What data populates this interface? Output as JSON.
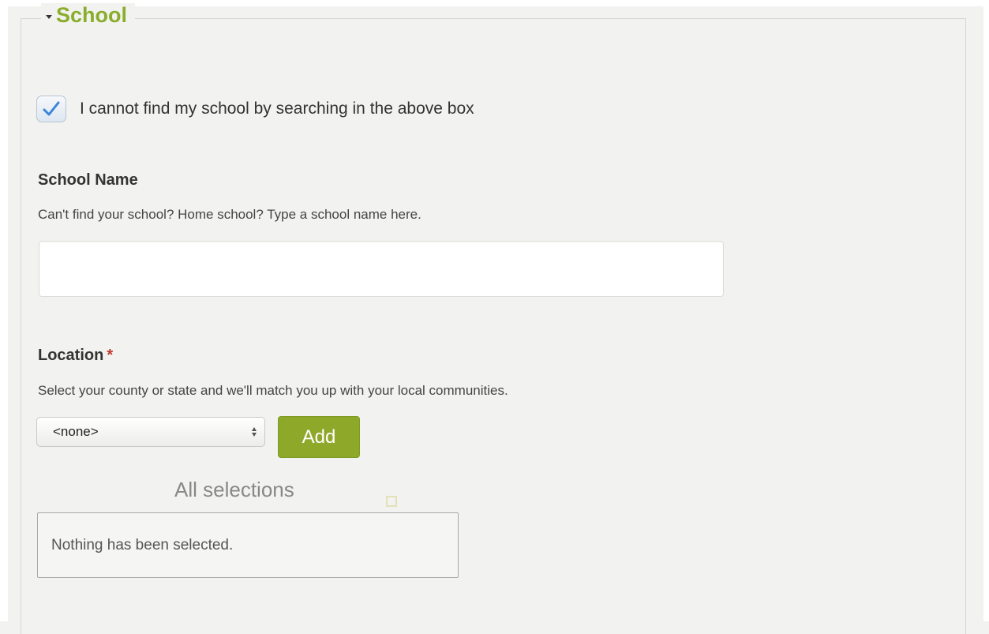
{
  "section": {
    "title": "School",
    "collapse_icon": "caret-down-icon"
  },
  "cannot_find": {
    "checked": true,
    "label": "I cannot find my school by searching in the above box"
  },
  "school_name": {
    "label": "School Name",
    "help": "Can't find your school? Home school? Type a school name here.",
    "value": ""
  },
  "location": {
    "label": "Location",
    "required_marker": "*",
    "help": "Select your county or state and we'll match you up with your local communities.",
    "select_value": "<none>",
    "add_label": "Add",
    "add_color": "#8ea92a"
  },
  "selections": {
    "title": "All selections",
    "empty_text": "Nothing has been selected."
  },
  "colors": {
    "accent": "#8aae2c",
    "required": "#c0392b"
  }
}
